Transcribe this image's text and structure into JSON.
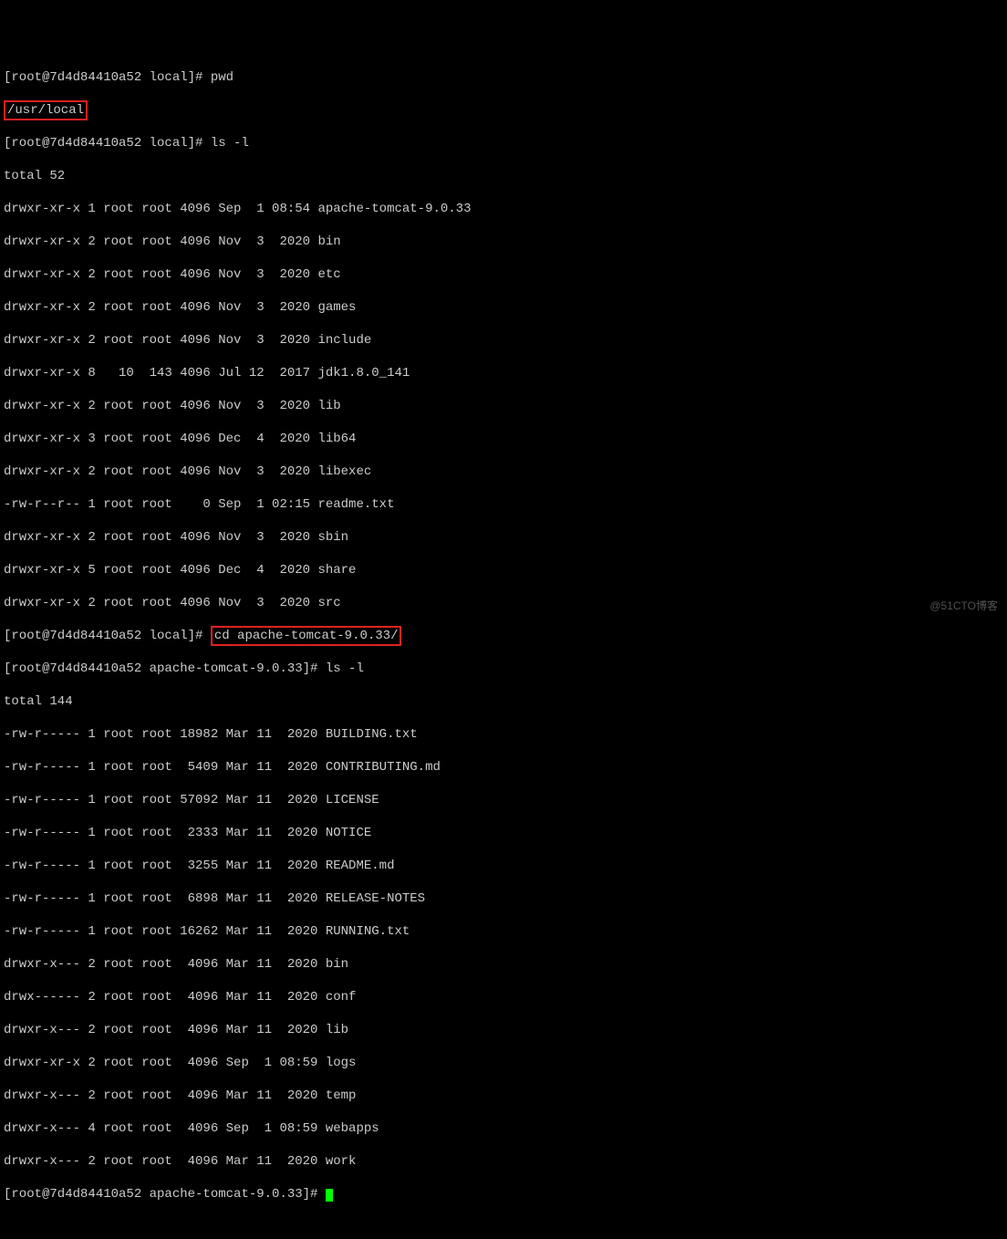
{
  "lines": {
    "l0": "[root@7d4d84410a52 local]# pwd",
    "l1_hl": "/usr/local",
    "l2": "[root@7d4d84410a52 local]# ls -l",
    "l3": "total 52",
    "l4": "drwxr-xr-x 1 root root 4096 Sep  1 08:54 apache-tomcat-9.0.33",
    "l5": "drwxr-xr-x 2 root root 4096 Nov  3  2020 bin",
    "l6": "drwxr-xr-x 2 root root 4096 Nov  3  2020 etc",
    "l7": "drwxr-xr-x 2 root root 4096 Nov  3  2020 games",
    "l8": "drwxr-xr-x 2 root root 4096 Nov  3  2020 include",
    "l9": "drwxr-xr-x 8   10  143 4096 Jul 12  2017 jdk1.8.0_141",
    "l10": "drwxr-xr-x 2 root root 4096 Nov  3  2020 lib",
    "l11": "drwxr-xr-x 3 root root 4096 Dec  4  2020 lib64",
    "l12": "drwxr-xr-x 2 root root 4096 Nov  3  2020 libexec",
    "l13": "-rw-r--r-- 1 root root    0 Sep  1 02:15 readme.txt",
    "l14": "drwxr-xr-x 2 root root 4096 Nov  3  2020 sbin",
    "l15": "drwxr-xr-x 5 root root 4096 Dec  4  2020 share",
    "l16": "drwxr-xr-x 2 root root 4096 Nov  3  2020 src",
    "l17_prefix": "[root@7d4d84410a52 local]# ",
    "l17_hl": "cd apache-tomcat-9.0.33/",
    "l18": "[root@7d4d84410a52 apache-tomcat-9.0.33]# ls -l",
    "l19": "total 144",
    "l20": "-rw-r----- 1 root root 18982 Mar 11  2020 BUILDING.txt",
    "l21": "-rw-r----- 1 root root  5409 Mar 11  2020 CONTRIBUTING.md",
    "l22": "-rw-r----- 1 root root 57092 Mar 11  2020 LICENSE",
    "l23": "-rw-r----- 1 root root  2333 Mar 11  2020 NOTICE",
    "l24": "-rw-r----- 1 root root  3255 Mar 11  2020 README.md",
    "l25": "-rw-r----- 1 root root  6898 Mar 11  2020 RELEASE-NOTES",
    "l26": "-rw-r----- 1 root root 16262 Mar 11  2020 RUNNING.txt",
    "l27": "drwxr-x--- 2 root root  4096 Mar 11  2020 bin",
    "l28": "drwx------ 2 root root  4096 Mar 11  2020 conf",
    "l29": "drwxr-x--- 2 root root  4096 Mar 11  2020 lib",
    "l30": "drwxr-xr-x 2 root root  4096 Sep  1 08:59 logs",
    "l31": "drwxr-x--- 2 root root  4096 Mar 11  2020 temp",
    "l32": "drwxr-x--- 4 root root  4096 Sep  1 08:59 webapps",
    "l33": "drwxr-x--- 2 root root  4096 Mar 11  2020 work",
    "l34": "[root@7d4d84410a52 apache-tomcat-9.0.33]# "
  },
  "watermark": "@51CTO博客"
}
